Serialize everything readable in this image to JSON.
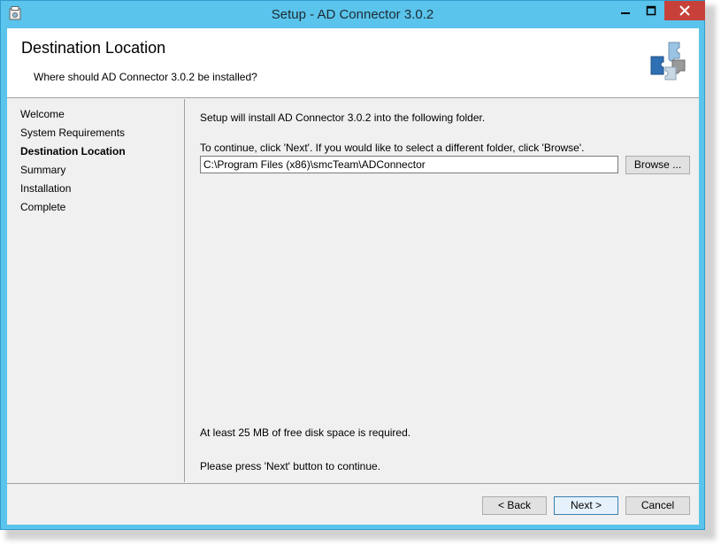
{
  "window": {
    "title": "Setup - AD Connector 3.0.2",
    "controls": {
      "minimize": "–",
      "maximize": "□",
      "close": "✕"
    }
  },
  "header": {
    "title": "Destination Location",
    "subtitle": "Where should AD Connector 3.0.2 be installed?"
  },
  "nav": {
    "items": [
      {
        "label": "Welcome"
      },
      {
        "label": "System Requirements"
      },
      {
        "label": "Destination Location"
      },
      {
        "label": "Summary"
      },
      {
        "label": "Installation"
      },
      {
        "label": "Complete"
      }
    ],
    "active": "Destination Location"
  },
  "main": {
    "intro": "Setup will install AD Connector 3.0.2 into the following folder.",
    "instruction": "To continue, click 'Next'. If you would like to select a different folder, click 'Browse'.",
    "path_value": "C:\\Program Files (x86)\\smcTeam\\ADConnector",
    "browse_label": "Browse ...",
    "disk_space": "At least 25 MB of free disk space is required.",
    "continue_note": "Please press 'Next' button to continue."
  },
  "footer": {
    "back_label": "< Back",
    "next_label": "Next >",
    "cancel_label": "Cancel"
  },
  "colors": {
    "titlebar": "#5ac4ec",
    "close_button": "#c7413a",
    "client_bg": "#f0f0f0"
  }
}
